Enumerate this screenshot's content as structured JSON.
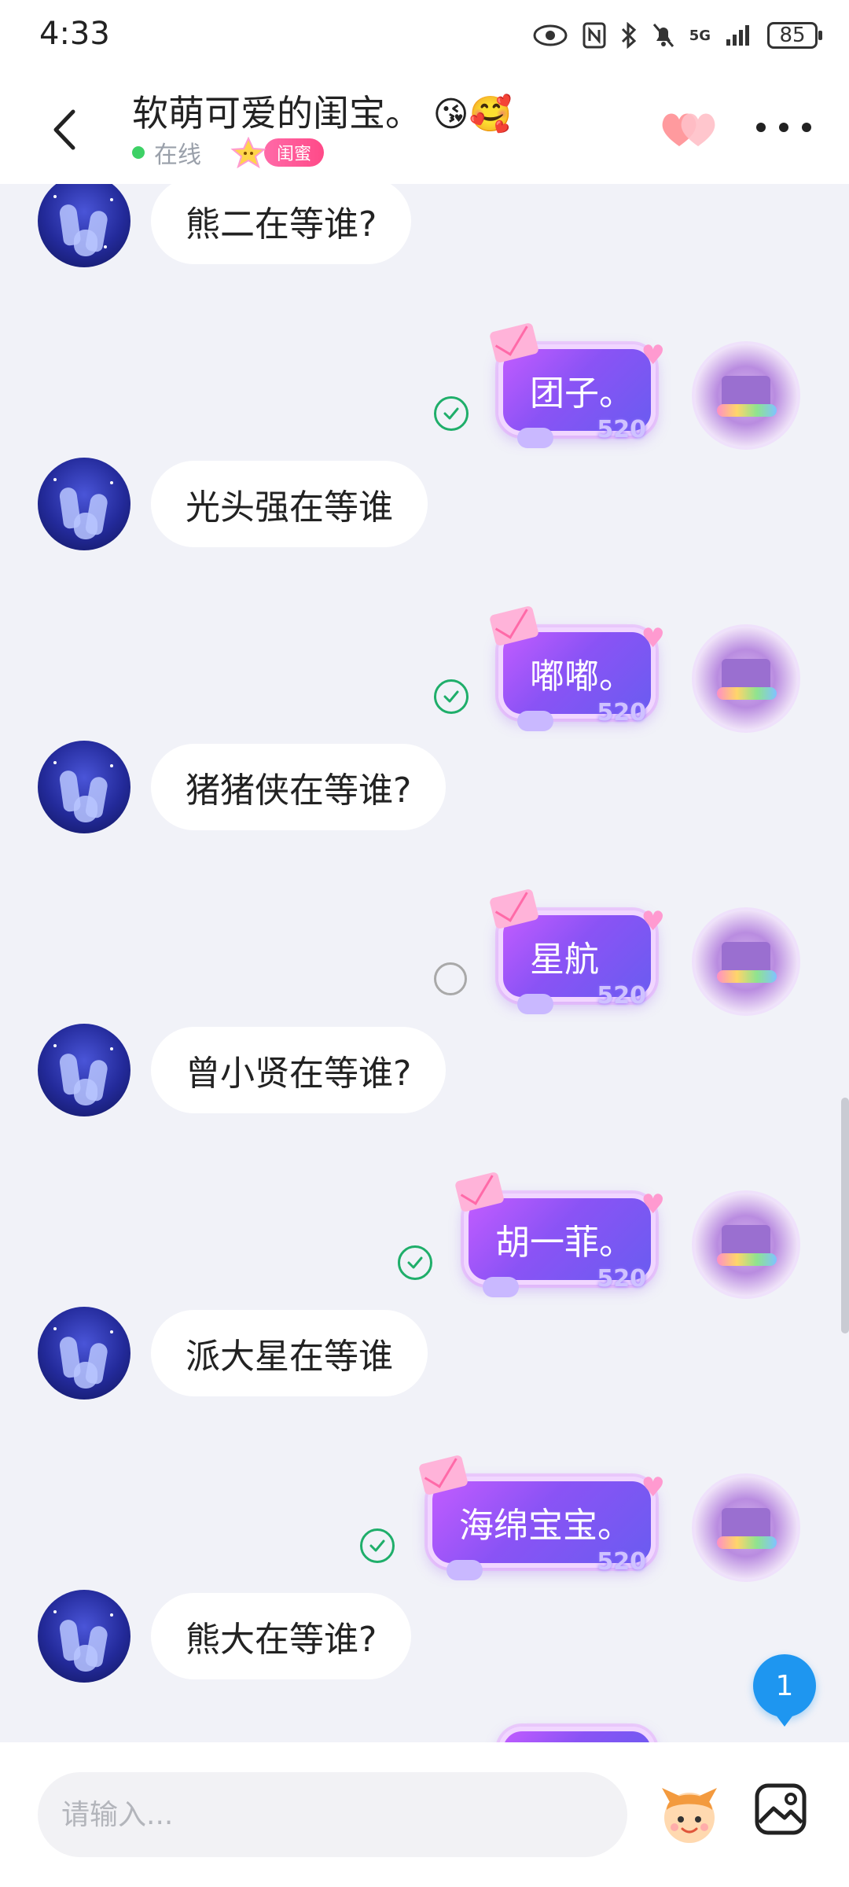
{
  "status_bar": {
    "time": "4:33",
    "battery": "85",
    "network": "5G",
    "icons": [
      "eye-icon",
      "nfc-icon",
      "bluetooth-icon",
      "mute-icon",
      "signal-icon",
      "battery-icon"
    ]
  },
  "header": {
    "title": "软萌可爱的闺宝。",
    "title_emoji": "😘🥰",
    "online_status": "在线",
    "bff_badge": "闺蜜"
  },
  "messages": [
    {
      "side": "left",
      "text": "熊二在等谁?"
    },
    {
      "side": "right",
      "text": "团子。",
      "status": "read"
    },
    {
      "side": "left",
      "text": "光头强在等谁"
    },
    {
      "side": "right",
      "text": "嘟嘟。",
      "status": "read"
    },
    {
      "side": "left",
      "text": "猪猪侠在等谁?"
    },
    {
      "side": "right",
      "text": "星航",
      "status": "sending"
    },
    {
      "side": "left",
      "text": "曾小贤在等谁?"
    },
    {
      "side": "right",
      "text": "胡一菲。",
      "status": "read"
    },
    {
      "side": "left",
      "text": "派大星在等谁"
    },
    {
      "side": "right",
      "text": "海绵宝宝。",
      "status": "read"
    },
    {
      "side": "left",
      "text": "熊大在等谁?"
    }
  ],
  "bubble_tag": "520",
  "unread_count": "1",
  "input": {
    "placeholder": "请输入..."
  },
  "colors": {
    "accent_blue": "#1e96f0",
    "online_green": "#3ed166",
    "read_check": "#1fae6a",
    "bubble_purple": "#8a53f5"
  }
}
